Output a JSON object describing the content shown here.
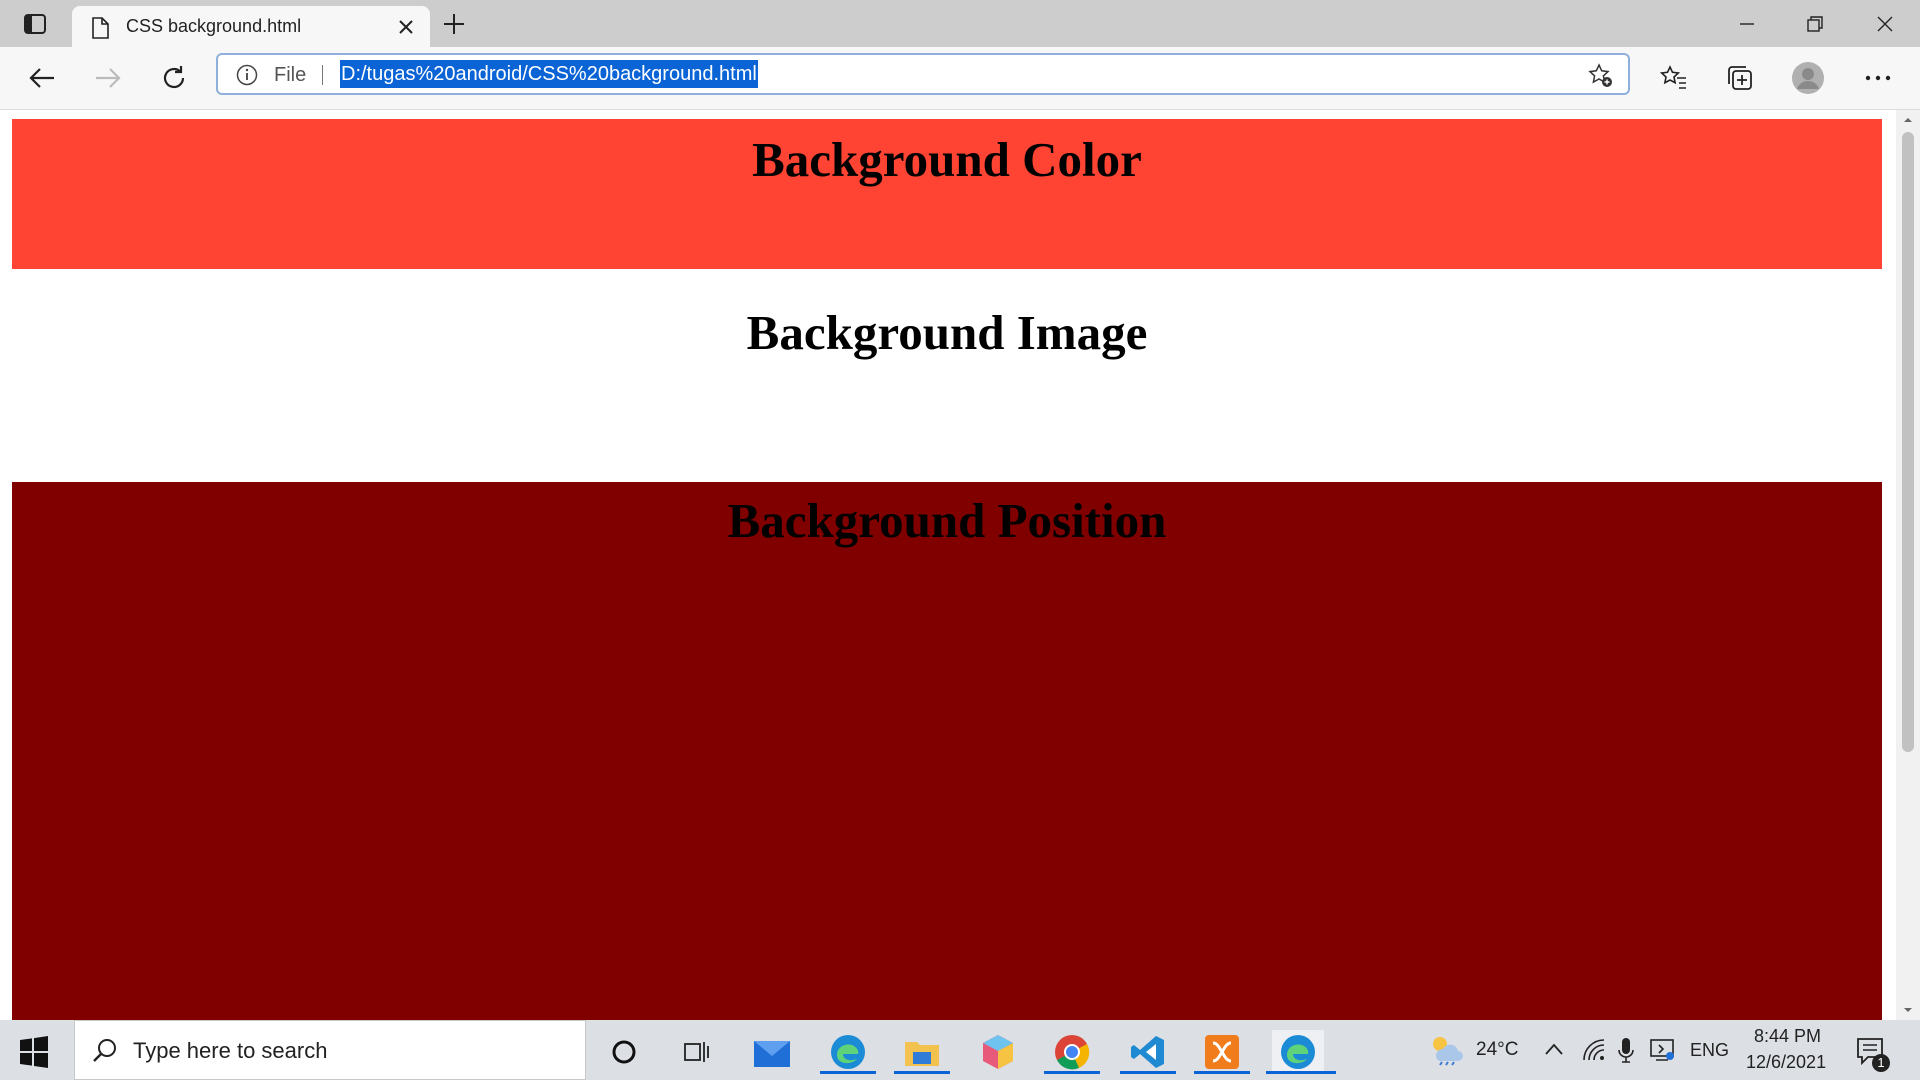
{
  "browser": {
    "tab_title": "CSS background.html",
    "scheme_label": "File",
    "url": "D:/tugas%20android/CSS%20background.html"
  },
  "page": {
    "sections": [
      {
        "heading": "Background Color",
        "bg": "#ff4433"
      },
      {
        "heading": "Background Image",
        "bg": "#ffffff"
      },
      {
        "heading": "Background Position",
        "bg": "#800000"
      }
    ]
  },
  "taskbar": {
    "search_placeholder": "Type here to search",
    "pinned_apps": [
      "cortana-icon",
      "task-view-icon",
      "mail-icon",
      "edge-icon",
      "file-explorer-icon",
      "app-cube-icon",
      "chrome-icon",
      "vscode-icon",
      "xampp-icon",
      "edge-active-icon"
    ],
    "weather": "24°C",
    "language": "ENG",
    "time": "8:44 PM",
    "date": "12/6/2021",
    "notification_count": "1"
  }
}
